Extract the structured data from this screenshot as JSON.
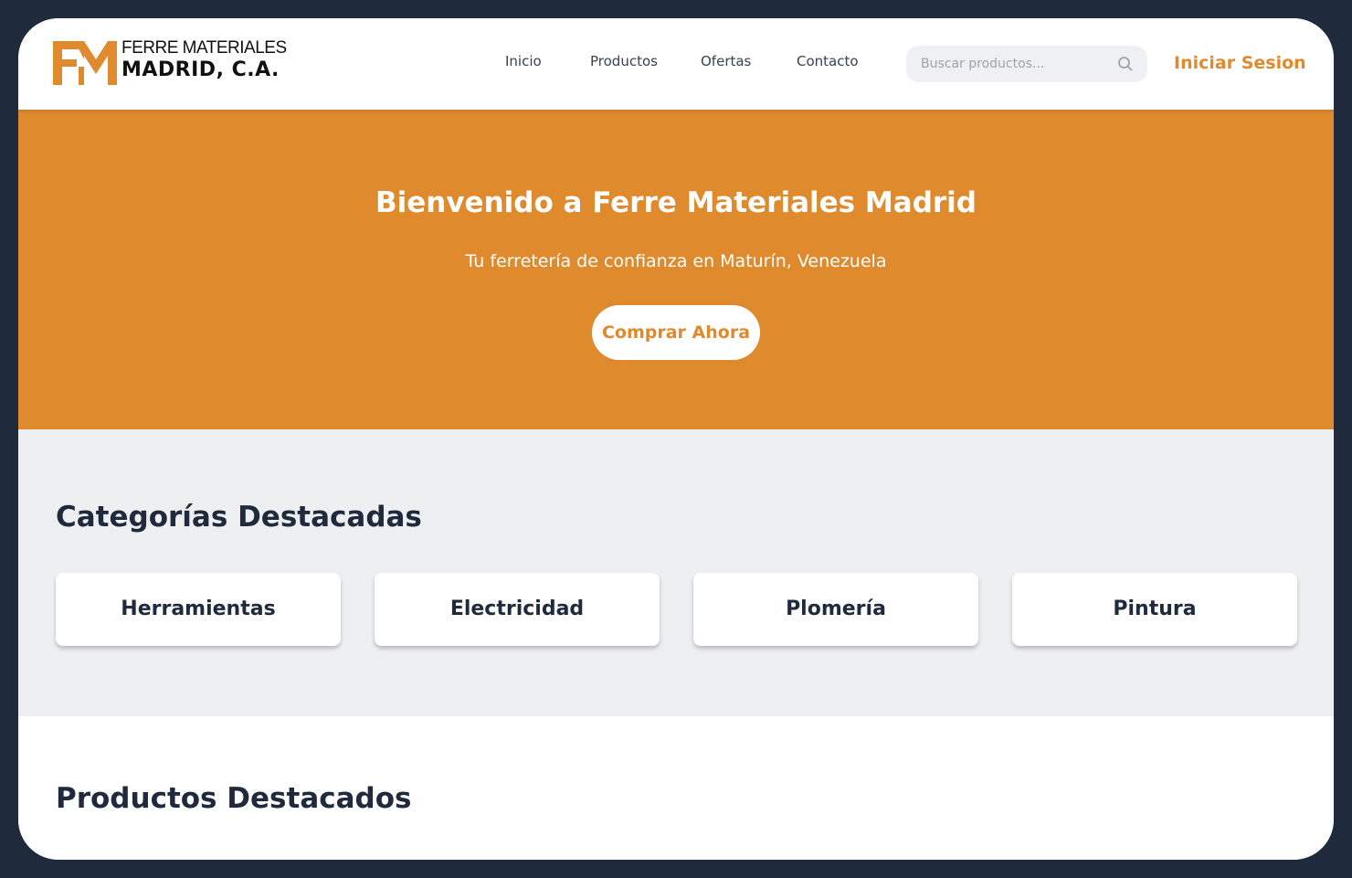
{
  "logo": {
    "line1": "FERRE MATERIALES",
    "line2": "MADRID, C.A.",
    "mark_icon": "fm-logo-icon"
  },
  "nav": {
    "items": [
      {
        "label": "Inicio"
      },
      {
        "label": "Productos"
      },
      {
        "label": "Ofertas"
      },
      {
        "label": "Contacto"
      }
    ]
  },
  "search": {
    "placeholder": "Buscar productos...",
    "value": "",
    "icon": "search-icon"
  },
  "login_label": "Iniciar Sesion",
  "hero": {
    "title": "Bienvenido a Ferre Materiales Madrid",
    "subtitle": "Tu ferretería de confianza en Maturín, Venezuela",
    "cta_label": "Comprar Ahora"
  },
  "categories": {
    "title": "Categorías Destacadas",
    "items": [
      {
        "label": "Herramientas"
      },
      {
        "label": "Electricidad"
      },
      {
        "label": "Plomería"
      },
      {
        "label": "Pintura"
      }
    ]
  },
  "products": {
    "title": "Productos Destacados"
  },
  "colors": {
    "accent": "#e08a2e",
    "dark": "#1f2a3c",
    "section_bg": "#eeeff1"
  }
}
